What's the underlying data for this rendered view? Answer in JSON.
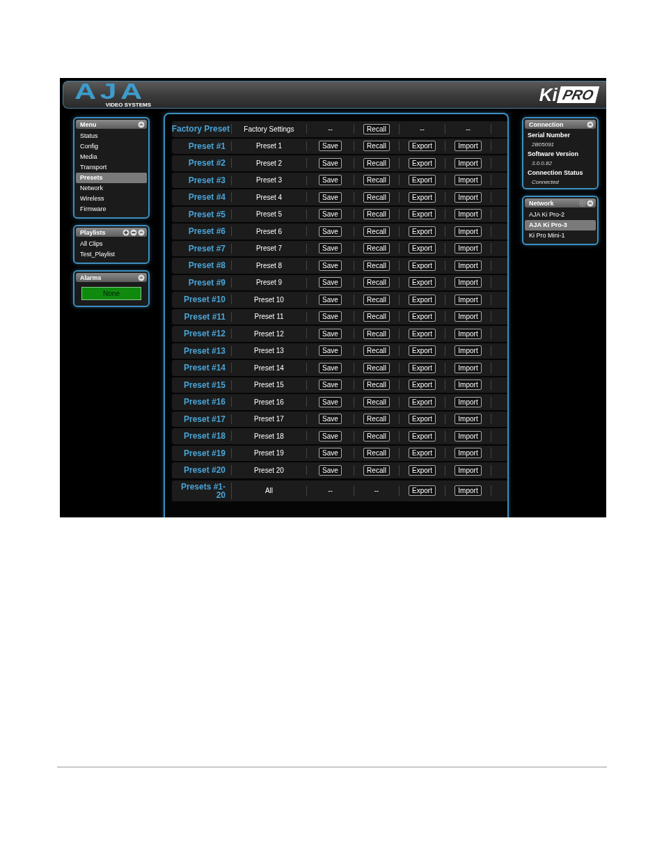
{
  "header": {
    "logo": "AJA",
    "logo_subtitle": "VIDEO SYSTEMS",
    "product_logo": {
      "left": "Ki",
      "right": "PRO"
    }
  },
  "sidebar": {
    "menu": {
      "title": "Menu",
      "items": [
        {
          "label": "Status",
          "selected": false
        },
        {
          "label": "Config",
          "selected": false
        },
        {
          "label": "Media",
          "selected": false
        },
        {
          "label": "Transport",
          "selected": false
        },
        {
          "label": "Presets",
          "selected": true
        },
        {
          "label": "Network",
          "selected": false
        },
        {
          "label": "Wireless",
          "selected": false
        },
        {
          "label": "Firmware",
          "selected": false
        }
      ]
    },
    "playlists": {
      "title": "Playlists",
      "items": [
        {
          "label": "All Clips",
          "selected": false
        },
        {
          "label": "Test_Playlist",
          "selected": false
        }
      ]
    },
    "alarms": {
      "title": "Alarms",
      "status": "None"
    }
  },
  "presets": {
    "rows": [
      {
        "label": "Factory Preset",
        "name": "Factory Settings",
        "actions": [
          {
            "kind": "text",
            "text": "--"
          },
          {
            "kind": "button",
            "text": "Recall"
          },
          {
            "kind": "text",
            "text": "--"
          },
          {
            "kind": "text",
            "text": "--"
          }
        ]
      },
      {
        "label": "Preset #1",
        "name": "Preset 1",
        "actions": [
          {
            "kind": "button",
            "text": "Save"
          },
          {
            "kind": "button",
            "text": "Recall"
          },
          {
            "kind": "button",
            "text": "Export"
          },
          {
            "kind": "button",
            "text": "Import"
          }
        ]
      },
      {
        "label": "Preset #2",
        "name": "Preset 2",
        "actions": [
          {
            "kind": "button",
            "text": "Save"
          },
          {
            "kind": "button",
            "text": "Recall"
          },
          {
            "kind": "button",
            "text": "Export"
          },
          {
            "kind": "button",
            "text": "Import"
          }
        ]
      },
      {
        "label": "Preset #3",
        "name": "Preset 3",
        "actions": [
          {
            "kind": "button",
            "text": "Save"
          },
          {
            "kind": "button",
            "text": "Recall"
          },
          {
            "kind": "button",
            "text": "Export"
          },
          {
            "kind": "button",
            "text": "Import"
          }
        ]
      },
      {
        "label": "Preset #4",
        "name": "Preset 4",
        "actions": [
          {
            "kind": "button",
            "text": "Save"
          },
          {
            "kind": "button",
            "text": "Recall"
          },
          {
            "kind": "button",
            "text": "Export"
          },
          {
            "kind": "button",
            "text": "Import"
          }
        ]
      },
      {
        "label": "Preset #5",
        "name": "Preset 5",
        "actions": [
          {
            "kind": "button",
            "text": "Save"
          },
          {
            "kind": "button",
            "text": "Recall"
          },
          {
            "kind": "button",
            "text": "Export"
          },
          {
            "kind": "button",
            "text": "Import"
          }
        ]
      },
      {
        "label": "Preset #6",
        "name": "Preset 6",
        "actions": [
          {
            "kind": "button",
            "text": "Save"
          },
          {
            "kind": "button",
            "text": "Recall"
          },
          {
            "kind": "button",
            "text": "Export"
          },
          {
            "kind": "button",
            "text": "Import"
          }
        ]
      },
      {
        "label": "Preset #7",
        "name": "Preset 7",
        "actions": [
          {
            "kind": "button",
            "text": "Save"
          },
          {
            "kind": "button",
            "text": "Recall"
          },
          {
            "kind": "button",
            "text": "Export"
          },
          {
            "kind": "button",
            "text": "Import"
          }
        ]
      },
      {
        "label": "Preset #8",
        "name": "Preset 8",
        "actions": [
          {
            "kind": "button",
            "text": "Save"
          },
          {
            "kind": "button",
            "text": "Recall"
          },
          {
            "kind": "button",
            "text": "Export"
          },
          {
            "kind": "button",
            "text": "Import"
          }
        ]
      },
      {
        "label": "Preset #9",
        "name": "Preset 9",
        "actions": [
          {
            "kind": "button",
            "text": "Save"
          },
          {
            "kind": "button",
            "text": "Recall"
          },
          {
            "kind": "button",
            "text": "Export"
          },
          {
            "kind": "button",
            "text": "Import"
          }
        ]
      },
      {
        "label": "Preset #10",
        "name": "Preset 10",
        "actions": [
          {
            "kind": "button",
            "text": "Save"
          },
          {
            "kind": "button",
            "text": "Recall"
          },
          {
            "kind": "button",
            "text": "Export"
          },
          {
            "kind": "button",
            "text": "Import"
          }
        ]
      },
      {
        "label": "Preset #11",
        "name": "Preset 11",
        "actions": [
          {
            "kind": "button",
            "text": "Save"
          },
          {
            "kind": "button",
            "text": "Recall"
          },
          {
            "kind": "button",
            "text": "Export"
          },
          {
            "kind": "button",
            "text": "Import"
          }
        ]
      },
      {
        "label": "Preset #12",
        "name": "Preset 12",
        "actions": [
          {
            "kind": "button",
            "text": "Save"
          },
          {
            "kind": "button",
            "text": "Recall"
          },
          {
            "kind": "button",
            "text": "Export"
          },
          {
            "kind": "button",
            "text": "Import"
          }
        ]
      },
      {
        "label": "Preset #13",
        "name": "Preset 13",
        "actions": [
          {
            "kind": "button",
            "text": "Save"
          },
          {
            "kind": "button",
            "text": "Recall"
          },
          {
            "kind": "button",
            "text": "Export"
          },
          {
            "kind": "button",
            "text": "Import"
          }
        ]
      },
      {
        "label": "Preset #14",
        "name": "Preset 14",
        "actions": [
          {
            "kind": "button",
            "text": "Save"
          },
          {
            "kind": "button",
            "text": "Recall"
          },
          {
            "kind": "button",
            "text": "Export"
          },
          {
            "kind": "button",
            "text": "Import"
          }
        ]
      },
      {
        "label": "Preset #15",
        "name": "Preset 15",
        "actions": [
          {
            "kind": "button",
            "text": "Save"
          },
          {
            "kind": "button",
            "text": "Recall"
          },
          {
            "kind": "button",
            "text": "Export"
          },
          {
            "kind": "button",
            "text": "Import"
          }
        ]
      },
      {
        "label": "Preset #16",
        "name": "Preset 16",
        "actions": [
          {
            "kind": "button",
            "text": "Save"
          },
          {
            "kind": "button",
            "text": "Recall"
          },
          {
            "kind": "button",
            "text": "Export"
          },
          {
            "kind": "button",
            "text": "Import"
          }
        ]
      },
      {
        "label": "Preset #17",
        "name": "Preset 17",
        "actions": [
          {
            "kind": "button",
            "text": "Save"
          },
          {
            "kind": "button",
            "text": "Recall"
          },
          {
            "kind": "button",
            "text": "Export"
          },
          {
            "kind": "button",
            "text": "Import"
          }
        ]
      },
      {
        "label": "Preset #18",
        "name": "Preset 18",
        "actions": [
          {
            "kind": "button",
            "text": "Save"
          },
          {
            "kind": "button",
            "text": "Recall"
          },
          {
            "kind": "button",
            "text": "Export"
          },
          {
            "kind": "button",
            "text": "Import"
          }
        ]
      },
      {
        "label": "Preset #19",
        "name": "Preset 19",
        "actions": [
          {
            "kind": "button",
            "text": "Save"
          },
          {
            "kind": "button",
            "text": "Recall"
          },
          {
            "kind": "button",
            "text": "Export"
          },
          {
            "kind": "button",
            "text": "Import"
          }
        ]
      },
      {
        "label": "Preset #20",
        "name": "Preset 20",
        "actions": [
          {
            "kind": "button",
            "text": "Save"
          },
          {
            "kind": "button",
            "text": "Recall"
          },
          {
            "kind": "button",
            "text": "Export"
          },
          {
            "kind": "button",
            "text": "Import"
          }
        ]
      },
      {
        "label": "Presets #1-20",
        "name": "All",
        "actions": [
          {
            "kind": "text",
            "text": "--"
          },
          {
            "kind": "text",
            "text": "--"
          },
          {
            "kind": "button",
            "text": "Export"
          },
          {
            "kind": "button",
            "text": "Import"
          }
        ]
      }
    ]
  },
  "connection": {
    "title": "Connection",
    "fields": [
      {
        "label": "Serial Number",
        "value": "2B05091"
      },
      {
        "label": "Software Version",
        "value": "3.0.0.82"
      },
      {
        "label": "Connection Status",
        "value": "Connected"
      }
    ]
  },
  "network": {
    "title": "Network",
    "items": [
      {
        "label": "AJA Ki Pro-2",
        "selected": false
      },
      {
        "label": "AJA Ki Pro-3",
        "selected": true
      },
      {
        "label": "Ki Pro Mini-1",
        "selected": false
      }
    ]
  }
}
